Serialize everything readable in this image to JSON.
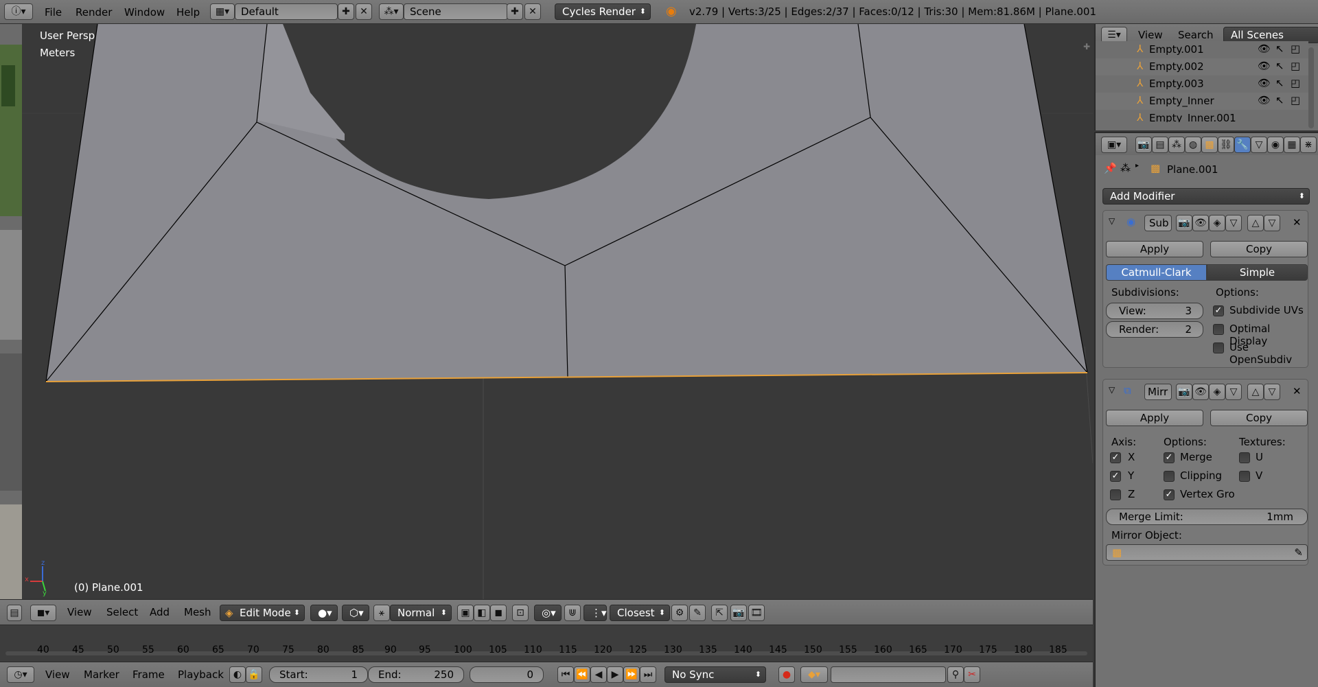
{
  "topbar": {
    "menus": [
      "File",
      "Render",
      "Window",
      "Help"
    ],
    "layout": "Default",
    "scene": "Scene",
    "engine": "Cycles Render",
    "stats": "v2.79 | Verts:3/25 | Edges:2/37 | Faces:0/12 | Tris:30 | Mem:81.86M | Plane.001"
  },
  "viewport": {
    "view_name": "User Persp",
    "units": "Meters",
    "object_label": "(0) Plane.001",
    "axis_x": "x",
    "axis_y": "y",
    "axis_z": "z"
  },
  "vpheader": {
    "menus": [
      "View",
      "Select",
      "Add",
      "Mesh"
    ],
    "mode": "Edit Mode",
    "orientation": "Normal",
    "snap": "Closest"
  },
  "timeline": {
    "ticks": [
      "40",
      "45",
      "50",
      "55",
      "60",
      "65",
      "70",
      "75",
      "80",
      "85",
      "90",
      "95",
      "100",
      "105",
      "110",
      "115",
      "120",
      "125",
      "130",
      "135",
      "140",
      "145",
      "150",
      "155",
      "160",
      "165",
      "170",
      "175",
      "180",
      "185"
    ],
    "menus": [
      "View",
      "Marker",
      "Frame",
      "Playback"
    ],
    "start_label": "Start:",
    "start_value": "1",
    "end_label": "End:",
    "end_value": "250",
    "current_frame": "0",
    "sync": "No Sync"
  },
  "outliner": {
    "tabs": [
      "View",
      "Search"
    ],
    "filter": "All Scenes",
    "items": [
      "Empty.001",
      "Empty.002",
      "Empty.003",
      "Empty_Inner",
      "Empty_Inner.001"
    ]
  },
  "properties": {
    "object_name": "Plane.001",
    "add_modifier": "Add Modifier",
    "subsurf": {
      "name": "Sub",
      "apply": "Apply",
      "copy": "Copy",
      "type_a": "Catmull-Clark",
      "type_b": "Simple",
      "subdivisions_label": "Subdivisions:",
      "options_label": "Options:",
      "view_label": "View:",
      "view_value": "3",
      "render_label": "Render:",
      "render_value": "2",
      "subdivide_uvs": "Subdivide UVs",
      "optimal_display": "Optimal Display",
      "use_opensubdiv": "Use OpenSubdiv"
    },
    "mirror": {
      "name": "Mirr",
      "apply": "Apply",
      "copy": "Copy",
      "axis_label": "Axis:",
      "options_label": "Options:",
      "textures_label": "Textures:",
      "x": "X",
      "y": "Y",
      "z": "Z",
      "merge": "Merge",
      "clipping": "Clipping",
      "vertex_groups": "Vertex Gro",
      "u": "U",
      "v": "V",
      "merge_limit_label": "Merge Limit:",
      "merge_limit_value": "1mm",
      "mirror_object_label": "Mirror Object:"
    }
  },
  "colors": {
    "accent_blue": "#5680c2",
    "mesh_face": "#8a8a90",
    "edge_selected": "#e8a13a",
    "viewport_bg": "#393939"
  }
}
